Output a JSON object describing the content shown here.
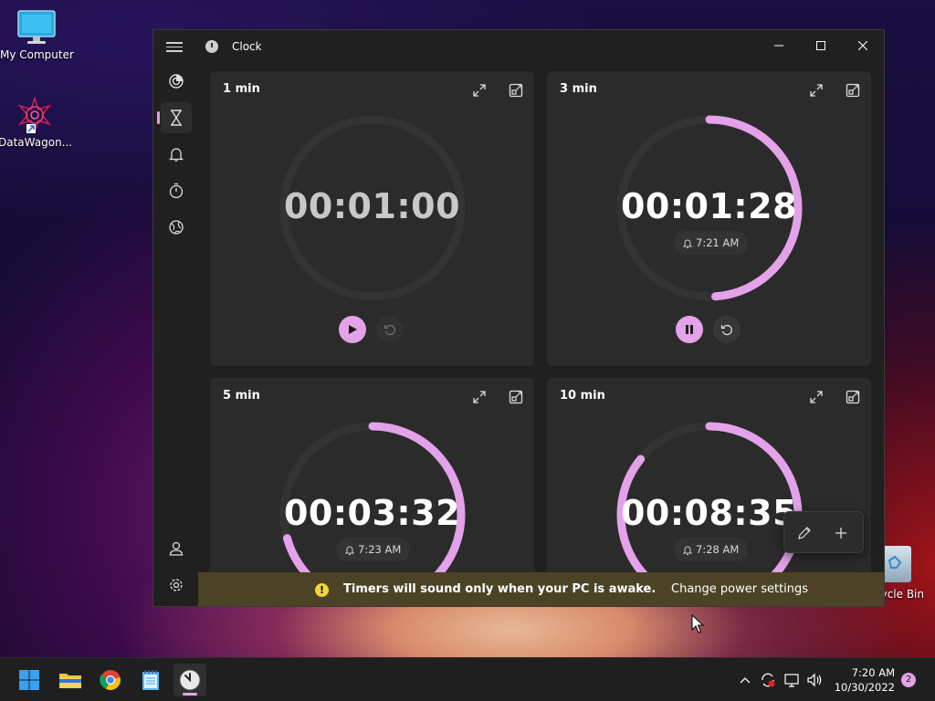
{
  "desktop": {
    "icons": [
      {
        "label": "My Computer"
      },
      {
        "label": "DataWagon..."
      }
    ],
    "recycle_label": "cycle Bin"
  },
  "window": {
    "title": "Clock",
    "nav": [
      "focus-sessions",
      "timer",
      "alarm",
      "stopwatch",
      "world-clock"
    ],
    "active_nav": "timer"
  },
  "timers": [
    {
      "name": "1 min",
      "time": "00:01:00",
      "running": false,
      "alarm": "",
      "progress": 1.0
    },
    {
      "name": "3 min",
      "time": "00:01:28",
      "running": true,
      "alarm": "7:21 AM",
      "progress": 0.489
    },
    {
      "name": "5 min",
      "time": "00:03:32",
      "running": true,
      "alarm": "7:23 AM",
      "progress": 0.707
    },
    {
      "name": "10 min",
      "time": "00:08:35",
      "running": true,
      "alarm": "7:28 AM",
      "progress": 0.858
    }
  ],
  "banner": {
    "message": "Timers will sound only when your PC is awake.",
    "link": "Change power settings"
  },
  "taskbar": {
    "time": "7:20 AM",
    "date": "10/30/2022",
    "notification_count": "2"
  },
  "colors": {
    "accent": "#e3a2e9",
    "track": "#333333",
    "banner": "#4c4326"
  }
}
